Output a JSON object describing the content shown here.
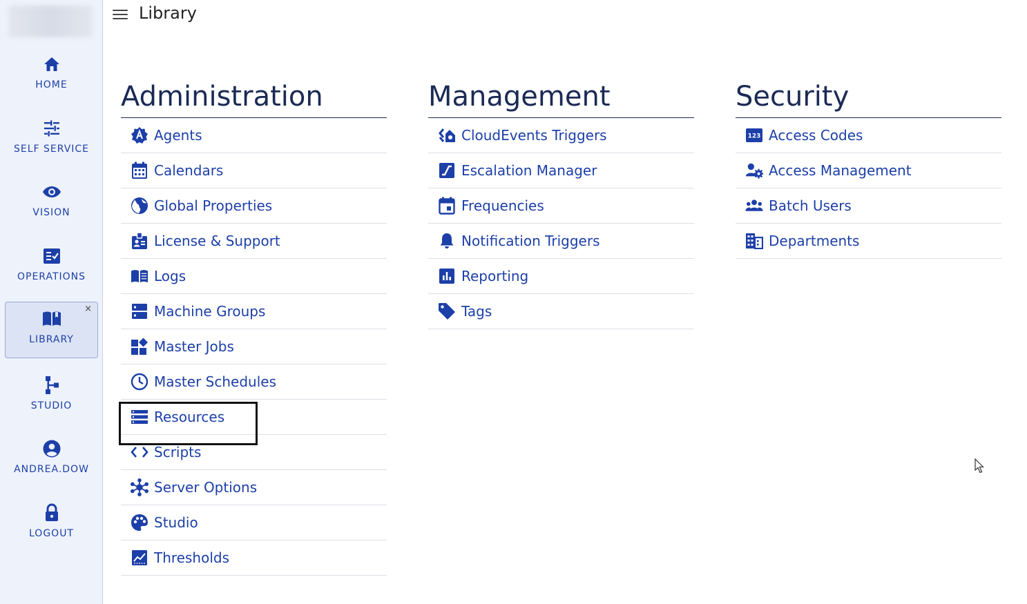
{
  "app": {
    "page_title": "Library"
  },
  "colors": {
    "accent": "#1c3fa8",
    "heading": "#1b2a55",
    "sidebar_bg": "#eef2fb",
    "active_bg": "#dbe3f4"
  },
  "sidebar": {
    "items": [
      {
        "label": "HOME",
        "icon": "home-icon"
      },
      {
        "label": "SELF SERVICE",
        "icon": "sliders-icon"
      },
      {
        "label": "VISION",
        "icon": "eye-icon"
      },
      {
        "label": "OPERATIONS",
        "icon": "checklist-icon"
      },
      {
        "label": "LIBRARY",
        "icon": "book-icon",
        "active": true,
        "close": "×"
      },
      {
        "label": "STUDIO",
        "icon": "hierarchy-icon"
      },
      {
        "label": "ANDREA.DOW",
        "icon": "user-icon"
      },
      {
        "label": "LOGOUT",
        "icon": "lock-icon"
      }
    ]
  },
  "columns": {
    "administration": {
      "title": "Administration",
      "items": [
        {
          "label": "Agents",
          "icon": "agent-badge-icon"
        },
        {
          "label": "Calendars",
          "icon": "calendar-icon"
        },
        {
          "label": "Global Properties",
          "icon": "globe-icon"
        },
        {
          "label": "License & Support",
          "icon": "id-badge-icon"
        },
        {
          "label": "Logs",
          "icon": "open-book-icon"
        },
        {
          "label": "Machine Groups",
          "icon": "server-stack-icon"
        },
        {
          "label": "Master Jobs",
          "icon": "widgets-icon"
        },
        {
          "label": "Master Schedules",
          "icon": "clock-icon"
        },
        {
          "label": "Resources",
          "icon": "list-bars-icon"
        },
        {
          "label": "Scripts",
          "icon": "code-icon"
        },
        {
          "label": "Server Options",
          "icon": "hub-icon"
        },
        {
          "label": "Studio",
          "icon": "palette-icon"
        },
        {
          "label": "Thresholds",
          "icon": "chart-icon"
        }
      ]
    },
    "management": {
      "title": "Management",
      "items": [
        {
          "label": "CloudEvents Triggers",
          "icon": "cloud-events-icon"
        },
        {
          "label": "Escalation Manager",
          "icon": "escalation-icon"
        },
        {
          "label": "Frequencies",
          "icon": "calendar-day-icon"
        },
        {
          "label": "Notification Triggers",
          "icon": "bell-icon"
        },
        {
          "label": "Reporting",
          "icon": "bar-chart-icon"
        },
        {
          "label": "Tags",
          "icon": "tag-icon"
        }
      ]
    },
    "security": {
      "title": "Security",
      "items": [
        {
          "label": "Access Codes",
          "icon": "numeric-badge-icon",
          "badge": "123"
        },
        {
          "label": "Access Management",
          "icon": "user-gear-icon"
        },
        {
          "label": "Batch Users",
          "icon": "group-icon"
        },
        {
          "label": "Departments",
          "icon": "building-icon"
        }
      ]
    }
  }
}
